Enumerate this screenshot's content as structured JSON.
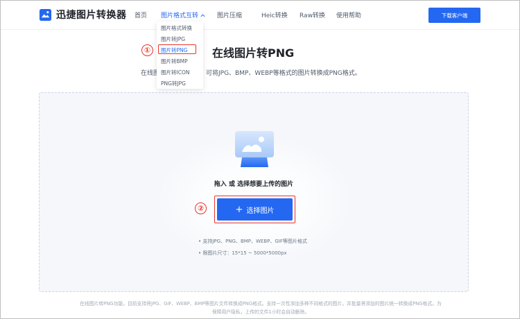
{
  "brand": {
    "name": "迅捷图片转换器",
    "accent": "#2468f2"
  },
  "nav": {
    "home": "首页",
    "format_convert": "图片格式互转",
    "compress": "图片压缩",
    "heic": "Heic转换",
    "raw": "Raw转换",
    "help": "使用帮助",
    "download": "下载客户端"
  },
  "dropdown": {
    "items": [
      "图片格式转换",
      "图片转JPG",
      "图片转PNG",
      "图片转BMP",
      "图片转ICON",
      "PNG转JPG"
    ],
    "selected": "图片转PNG"
  },
  "steps": {
    "one": "①",
    "two": "②"
  },
  "hero": {
    "title": "在线图片转PNG",
    "subtitle_prefix": "在线图",
    "subtitle": "可将JPG、BMP、WEBP等格式的图片转换成PNG格式。"
  },
  "upload": {
    "prompt": "拖入 或 选择想要上传的图片",
    "button": "选择图片",
    "notes": [
      "• 支持JPG、PNG、BMP、WEBP、GIF等图片格式",
      "• 限图片尺寸：15*15 ~ 5000*5000px"
    ]
  },
  "footer": {
    "line1": "在线图片转PNG功能，目前支持将JPG、GIF、WEBP、BMP等图片文件转换成PNG格式。支持一次性添加多种不同格式的图片，并批量将添加的图片统一转换成PNG格式。为",
    "line2": "保障用户隐私，上传的文件1小时会自动删除。"
  },
  "colors": {
    "highlight": "#e8322a",
    "primary": "#2468f2"
  },
  "icons": [
    "logo-icon",
    "chevron-down-icon",
    "upload-image-icon",
    "plus-icon"
  ]
}
